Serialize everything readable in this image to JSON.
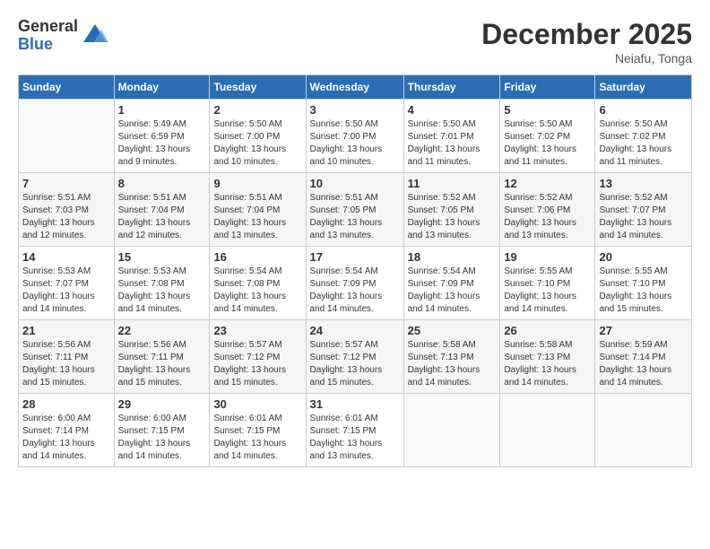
{
  "logo": {
    "general": "General",
    "blue": "Blue"
  },
  "title": "December 2025",
  "location": "Neiafu, Tonga",
  "days_of_week": [
    "Sunday",
    "Monday",
    "Tuesday",
    "Wednesday",
    "Thursday",
    "Friday",
    "Saturday"
  ],
  "weeks": [
    [
      {
        "day": "",
        "sunrise": "",
        "sunset": "",
        "daylight": ""
      },
      {
        "day": "1",
        "sunrise": "Sunrise: 5:49 AM",
        "sunset": "Sunset: 6:59 PM",
        "daylight": "Daylight: 13 hours and 9 minutes."
      },
      {
        "day": "2",
        "sunrise": "Sunrise: 5:50 AM",
        "sunset": "Sunset: 7:00 PM",
        "daylight": "Daylight: 13 hours and 10 minutes."
      },
      {
        "day": "3",
        "sunrise": "Sunrise: 5:50 AM",
        "sunset": "Sunset: 7:00 PM",
        "daylight": "Daylight: 13 hours and 10 minutes."
      },
      {
        "day": "4",
        "sunrise": "Sunrise: 5:50 AM",
        "sunset": "Sunset: 7:01 PM",
        "daylight": "Daylight: 13 hours and 11 minutes."
      },
      {
        "day": "5",
        "sunrise": "Sunrise: 5:50 AM",
        "sunset": "Sunset: 7:02 PM",
        "daylight": "Daylight: 13 hours and 11 minutes."
      },
      {
        "day": "6",
        "sunrise": "Sunrise: 5:50 AM",
        "sunset": "Sunset: 7:02 PM",
        "daylight": "Daylight: 13 hours and 11 minutes."
      }
    ],
    [
      {
        "day": "7",
        "sunrise": "Sunrise: 5:51 AM",
        "sunset": "Sunset: 7:03 PM",
        "daylight": "Daylight: 13 hours and 12 minutes."
      },
      {
        "day": "8",
        "sunrise": "Sunrise: 5:51 AM",
        "sunset": "Sunset: 7:04 PM",
        "daylight": "Daylight: 13 hours and 12 minutes."
      },
      {
        "day": "9",
        "sunrise": "Sunrise: 5:51 AM",
        "sunset": "Sunset: 7:04 PM",
        "daylight": "Daylight: 13 hours and 13 minutes."
      },
      {
        "day": "10",
        "sunrise": "Sunrise: 5:51 AM",
        "sunset": "Sunset: 7:05 PM",
        "daylight": "Daylight: 13 hours and 13 minutes."
      },
      {
        "day": "11",
        "sunrise": "Sunrise: 5:52 AM",
        "sunset": "Sunset: 7:05 PM",
        "daylight": "Daylight: 13 hours and 13 minutes."
      },
      {
        "day": "12",
        "sunrise": "Sunrise: 5:52 AM",
        "sunset": "Sunset: 7:06 PM",
        "daylight": "Daylight: 13 hours and 13 minutes."
      },
      {
        "day": "13",
        "sunrise": "Sunrise: 5:52 AM",
        "sunset": "Sunset: 7:07 PM",
        "daylight": "Daylight: 13 hours and 14 minutes."
      }
    ],
    [
      {
        "day": "14",
        "sunrise": "Sunrise: 5:53 AM",
        "sunset": "Sunset: 7:07 PM",
        "daylight": "Daylight: 13 hours and 14 minutes."
      },
      {
        "day": "15",
        "sunrise": "Sunrise: 5:53 AM",
        "sunset": "Sunset: 7:08 PM",
        "daylight": "Daylight: 13 hours and 14 minutes."
      },
      {
        "day": "16",
        "sunrise": "Sunrise: 5:54 AM",
        "sunset": "Sunset: 7:08 PM",
        "daylight": "Daylight: 13 hours and 14 minutes."
      },
      {
        "day": "17",
        "sunrise": "Sunrise: 5:54 AM",
        "sunset": "Sunset: 7:09 PM",
        "daylight": "Daylight: 13 hours and 14 minutes."
      },
      {
        "day": "18",
        "sunrise": "Sunrise: 5:54 AM",
        "sunset": "Sunset: 7:09 PM",
        "daylight": "Daylight: 13 hours and 14 minutes."
      },
      {
        "day": "19",
        "sunrise": "Sunrise: 5:55 AM",
        "sunset": "Sunset: 7:10 PM",
        "daylight": "Daylight: 13 hours and 14 minutes."
      },
      {
        "day": "20",
        "sunrise": "Sunrise: 5:55 AM",
        "sunset": "Sunset: 7:10 PM",
        "daylight": "Daylight: 13 hours and 15 minutes."
      }
    ],
    [
      {
        "day": "21",
        "sunrise": "Sunrise: 5:56 AM",
        "sunset": "Sunset: 7:11 PM",
        "daylight": "Daylight: 13 hours and 15 minutes."
      },
      {
        "day": "22",
        "sunrise": "Sunrise: 5:56 AM",
        "sunset": "Sunset: 7:11 PM",
        "daylight": "Daylight: 13 hours and 15 minutes."
      },
      {
        "day": "23",
        "sunrise": "Sunrise: 5:57 AM",
        "sunset": "Sunset: 7:12 PM",
        "daylight": "Daylight: 13 hours and 15 minutes."
      },
      {
        "day": "24",
        "sunrise": "Sunrise: 5:57 AM",
        "sunset": "Sunset: 7:12 PM",
        "daylight": "Daylight: 13 hours and 15 minutes."
      },
      {
        "day": "25",
        "sunrise": "Sunrise: 5:58 AM",
        "sunset": "Sunset: 7:13 PM",
        "daylight": "Daylight: 13 hours and 14 minutes."
      },
      {
        "day": "26",
        "sunrise": "Sunrise: 5:58 AM",
        "sunset": "Sunset: 7:13 PM",
        "daylight": "Daylight: 13 hours and 14 minutes."
      },
      {
        "day": "27",
        "sunrise": "Sunrise: 5:59 AM",
        "sunset": "Sunset: 7:14 PM",
        "daylight": "Daylight: 13 hours and 14 minutes."
      }
    ],
    [
      {
        "day": "28",
        "sunrise": "Sunrise: 6:00 AM",
        "sunset": "Sunset: 7:14 PM",
        "daylight": "Daylight: 13 hours and 14 minutes."
      },
      {
        "day": "29",
        "sunrise": "Sunrise: 6:00 AM",
        "sunset": "Sunset: 7:15 PM",
        "daylight": "Daylight: 13 hours and 14 minutes."
      },
      {
        "day": "30",
        "sunrise": "Sunrise: 6:01 AM",
        "sunset": "Sunset: 7:15 PM",
        "daylight": "Daylight: 13 hours and 14 minutes."
      },
      {
        "day": "31",
        "sunrise": "Sunrise: 6:01 AM",
        "sunset": "Sunset: 7:15 PM",
        "daylight": "Daylight: 13 hours and 13 minutes."
      },
      {
        "day": "",
        "sunrise": "",
        "sunset": "",
        "daylight": ""
      },
      {
        "day": "",
        "sunrise": "",
        "sunset": "",
        "daylight": ""
      },
      {
        "day": "",
        "sunrise": "",
        "sunset": "",
        "daylight": ""
      }
    ]
  ]
}
